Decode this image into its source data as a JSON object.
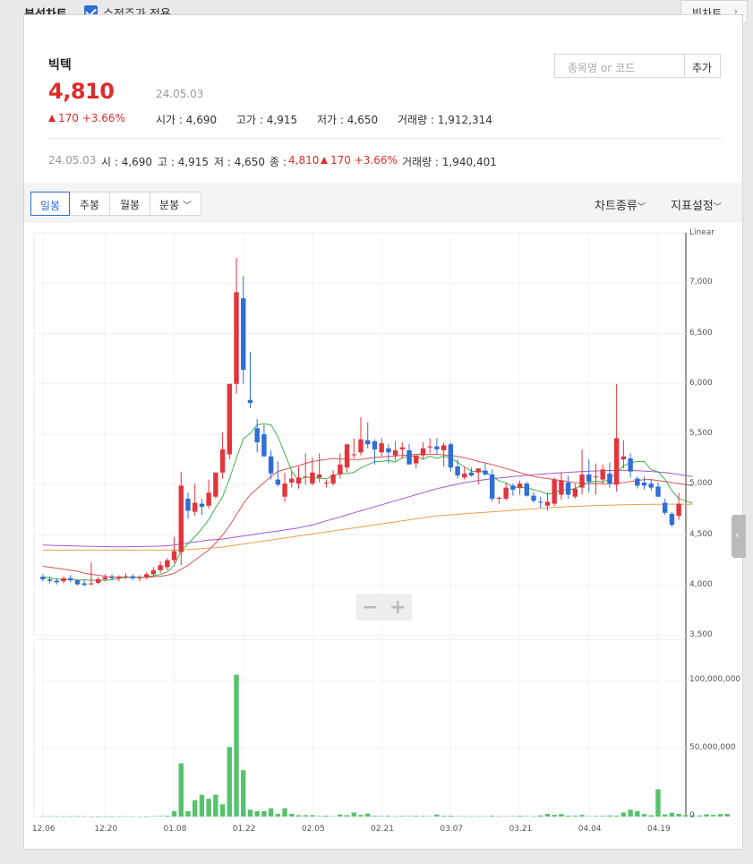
{
  "header": {
    "title": "분석차트",
    "adjusted_label": "수정주가 적용",
    "adjusted_checked": true,
    "big_chart_label": "빅차트"
  },
  "stock": {
    "name": "빅텍",
    "price": "4,810",
    "date": "24.05.03",
    "change": "170 +3.66%",
    "open": "시가 : 4,690",
    "high": "고가 : 4,915",
    "low": "저가 : 4,650",
    "volume": "거래량 : 1,912,314"
  },
  "search": {
    "placeholder": "종목명 or 코드",
    "add_label": "추가"
  },
  "summary": {
    "date": "24.05.03",
    "open": "시 : 4,690",
    "high": "고 : 4,915",
    "low": "저 : 4,650",
    "close_label": "종 :",
    "close": "4,810",
    "change": "170 +3.66%",
    "volume": "거래량 : 1,940,401"
  },
  "toolbar": {
    "tabs": [
      "일봉",
      "주봉",
      "월봉",
      "분봉"
    ],
    "active_tab": "일봉",
    "chart_type_label": "차트종류",
    "indicator_label": "지표설정"
  },
  "colors": {
    "up": "#e3343c",
    "down": "#2f6ed6",
    "ma5": "#3cb44b",
    "ma20": "#d9534f",
    "ma60": "#a855d6",
    "ma120": "#e8a04a",
    "volume": "#56c26e"
  },
  "chart_data": {
    "type": "candlestick",
    "scale_label": "Linear",
    "ylim": [
      3500,
      7500
    ],
    "yticks": [
      "7,000",
      "6,500",
      "6,000",
      "5,500",
      "5,000",
      "4,500",
      "4,000",
      "3,500"
    ],
    "volume_ylim": [
      0,
      130000000
    ],
    "volume_ticks": [
      "100,000,000",
      "50,000,000",
      "0"
    ],
    "x_labels": [
      "12.06",
      "12.20",
      "01.08",
      "01.22",
      "02.05",
      "02.21",
      "03.07",
      "03.21",
      "04.04",
      "04.19"
    ],
    "candles": [
      [
        4085,
        4110,
        4040,
        4060
      ],
      [
        4060,
        4090,
        4020,
        4045
      ],
      [
        4045,
        4070,
        4010,
        4030
      ],
      [
        4040,
        4090,
        4020,
        4070
      ],
      [
        4070,
        4100,
        4030,
        4050
      ],
      [
        4050,
        4060,
        4000,
        4010
      ],
      [
        4020,
        4050,
        3990,
        4005
      ],
      [
        4010,
        4230,
        4000,
        4020
      ],
      [
        4025,
        4080,
        4010,
        4060
      ],
      [
        4060,
        4110,
        4040,
        4080
      ],
      [
        4080,
        4110,
        4050,
        4070
      ],
      [
        4070,
        4100,
        4040,
        4085
      ],
      [
        4085,
        4120,
        4060,
        4090
      ],
      [
        4090,
        4110,
        4050,
        4070
      ],
      [
        4070,
        4100,
        4040,
        4080
      ],
      [
        4080,
        4130,
        4060,
        4110
      ],
      [
        4110,
        4180,
        4090,
        4150
      ],
      [
        4150,
        4240,
        4120,
        4200
      ],
      [
        4180,
        4270,
        4150,
        4250
      ],
      [
        4250,
        4480,
        4220,
        4340
      ],
      [
        4330,
        5130,
        4200,
        4990
      ],
      [
        4860,
        4920,
        4660,
        4740
      ],
      [
        4730,
        5010,
        4690,
        4820
      ],
      [
        4810,
        4860,
        4700,
        4780
      ],
      [
        4790,
        5050,
        4760,
        4920
      ],
      [
        4880,
        5030,
        4860,
        5120
      ],
      [
        5120,
        5520,
        5060,
        5350
      ],
      [
        5300,
        6000,
        5250,
        6000
      ],
      [
        6000,
        7250,
        5900,
        6910
      ],
      [
        6850,
        7070,
        6000,
        6140
      ],
      [
        5840,
        6320,
        5760,
        5810
      ],
      [
        5560,
        5650,
        5320,
        5420
      ],
      [
        5500,
        5590,
        5320,
        5280
      ],
      [
        5280,
        5340,
        5050,
        5110
      ],
      [
        5050,
        5230,
        4980,
        5000
      ],
      [
        4880,
        5120,
        4830,
        5010
      ],
      [
        5020,
        5130,
        4970,
        5060
      ],
      [
        5010,
        5180,
        4960,
        5070
      ],
      [
        5070,
        5310,
        5000,
        5080
      ],
      [
        5010,
        5270,
        4990,
        5120
      ],
      [
        5070,
        5310,
        5020,
        5100
      ],
      [
        5020,
        5050,
        4970,
        5020
      ],
      [
        5010,
        5140,
        4990,
        5100
      ],
      [
        5100,
        5310,
        5060,
        5200
      ],
      [
        5170,
        5370,
        5120,
        5400
      ],
      [
        5300,
        5460,
        5260,
        5300
      ],
      [
        5320,
        5670,
        5290,
        5450
      ],
      [
        5440,
        5620,
        5360,
        5400
      ],
      [
        5430,
        5450,
        5200,
        5350
      ],
      [
        5320,
        5460,
        5280,
        5410
      ],
      [
        5360,
        5400,
        5210,
        5320
      ],
      [
        5290,
        5430,
        5240,
        5340
      ],
      [
        5350,
        5420,
        5260,
        5370
      ],
      [
        5340,
        5400,
        5220,
        5200
      ],
      [
        5210,
        5280,
        5160,
        5290
      ],
      [
        5290,
        5420,
        5250,
        5360
      ],
      [
        5370,
        5460,
        5310,
        5380
      ],
      [
        5380,
        5460,
        5300,
        5350
      ],
      [
        5340,
        5420,
        5180,
        5390
      ],
      [
        5400,
        5420,
        5130,
        5170
      ],
      [
        5180,
        5250,
        5060,
        5090
      ],
      [
        5070,
        5180,
        5050,
        5110
      ],
      [
        5120,
        5170,
        5080,
        5090
      ],
      [
        5120,
        5160,
        5000,
        5160
      ],
      [
        5140,
        5210,
        5090,
        5100
      ],
      [
        5100,
        5150,
        4830,
        4860
      ],
      [
        4860,
        4880,
        4810,
        4870
      ],
      [
        4860,
        5020,
        4840,
        4970
      ],
      [
        4990,
        5010,
        4890,
        4950
      ],
      [
        4970,
        5040,
        4900,
        5010
      ],
      [
        5010,
        5030,
        4880,
        4890
      ],
      [
        4890,
        4920,
        4820,
        4840
      ],
      [
        4830,
        4880,
        4770,
        4820
      ],
      [
        4790,
        4920,
        4740,
        4830
      ],
      [
        4810,
        5070,
        4790,
        5050
      ],
      [
        4900,
        5120,
        4850,
        5040
      ],
      [
        5020,
        5090,
        4860,
        4900
      ],
      [
        4880,
        5010,
        4860,
        4960
      ],
      [
        4970,
        5350,
        4900,
        5100
      ],
      [
        5100,
        5250,
        4920,
        5030
      ],
      [
        5080,
        5210,
        4900,
        5080
      ],
      [
        5050,
        5200,
        5000,
        5150
      ],
      [
        5110,
        5220,
        4970,
        5010
      ],
      [
        5000,
        6000,
        4930,
        5460
      ],
      [
        5250,
        5440,
        5160,
        5280
      ],
      [
        5260,
        5310,
        5070,
        5130
      ],
      [
        5060,
        5080,
        4960,
        4990
      ],
      [
        5020,
        5080,
        4950,
        4990
      ],
      [
        5010,
        5050,
        4940,
        4970
      ],
      [
        4980,
        5020,
        4880,
        4880
      ],
      [
        4820,
        4860,
        4700,
        4720
      ],
      [
        4710,
        4730,
        4580,
        4600
      ],
      [
        4690,
        4915,
        4650,
        4810
      ]
    ],
    "volumes": [
      0.2,
      0.2,
      0.2,
      0.1,
      0.2,
      0.2,
      0.2,
      0.1,
      0.1,
      0.2,
      0.1,
      0.1,
      0.2,
      0.1,
      0.1,
      0.1,
      0.3,
      0.4,
      0.6,
      4.0,
      39.0,
      4.0,
      12.0,
      16.0,
      13.0,
      16.0,
      9.0,
      51.0,
      104.0,
      34.0,
      5.0,
      4.0,
      4.0,
      6.0,
      2.0,
      6.0,
      2.0,
      1.0,
      1.0,
      1.0,
      0.4,
      0.6,
      0.3,
      1.5,
      1.0,
      3.0,
      1.2,
      2.2,
      0.5,
      0.4,
      0.5,
      0.3,
      0.4,
      0.3,
      0.6,
      0.4,
      0.3,
      1.5,
      0.5,
      0.6,
      0.3,
      0.3,
      0.2,
      0.3,
      0.3,
      0.5,
      0.3,
      0.2,
      0.3,
      0.6,
      0.3,
      0.2,
      0.8,
      2.0,
      1.2,
      1.8,
      0.6,
      0.7,
      1.2,
      0.3,
      0.4,
      0.5,
      0.8,
      0.7,
      3.0,
      5.0,
      4.0,
      1.8,
      0.9,
      20.0,
      1.5,
      2.8,
      2.0,
      1.0,
      0.9,
      0.8,
      1.6,
      1.2,
      1.8,
      1.9
    ],
    "volume_unit": "million",
    "ma5": [
      4085,
      4076,
      4063,
      4057,
      4063,
      4052,
      4055,
      4050,
      4050,
      4050,
      4055,
      4069,
      4080,
      4079,
      4077,
      4083,
      4096,
      4107,
      4134,
      4199,
      4341,
      4413,
      4482,
      4563,
      4653,
      4774,
      4878,
      5059,
      5261,
      5455,
      5510,
      5596,
      5602,
      5594,
      5477,
      5307,
      5134,
      5040,
      5077,
      5066,
      5064,
      5057,
      5083,
      5110,
      5109,
      5122,
      5165,
      5197,
      5227,
      5230,
      5239,
      5226,
      5265,
      5283,
      5280,
      5252,
      5282,
      5262,
      5281,
      5267,
      5219,
      5176,
      5134,
      5129,
      5131,
      5079,
      5037,
      5017,
      4977,
      4969,
      4973,
      4948,
      4933,
      4904,
      4918,
      4949,
      4945,
      4962,
      4993,
      5023,
      5032,
      5030,
      5055,
      5116,
      5187,
      5218,
      5229,
      5230,
      5148,
      5128,
      5050,
      4940,
      4862,
      4836,
      4815
    ],
    "ma20": [
      4190,
      4180,
      4170,
      4160,
      4150,
      4140,
      4120,
      4110,
      4100,
      4090,
      4085,
      4082,
      4080,
      4080,
      4080,
      4080,
      4085,
      4090,
      4100,
      4120,
      4160,
      4200,
      4250,
      4300,
      4350,
      4420,
      4500,
      4590,
      4700,
      4810,
      4900,
      4960,
      5020,
      5080,
      5130,
      5150,
      5170,
      5190,
      5210,
      5230,
      5240,
      5250,
      5260,
      5255,
      5250,
      5248,
      5250,
      5260,
      5270,
      5275,
      5280,
      5285,
      5290,
      5295,
      5300,
      5300,
      5300,
      5300,
      5295,
      5290,
      5280,
      5265,
      5250,
      5230,
      5215,
      5200,
      5180,
      5160,
      5140,
      5120,
      5100,
      5080,
      5070,
      5060,
      5050,
      5040,
      5030,
      5020,
      5015,
      5010,
      5010,
      5010,
      5010,
      5015,
      5020,
      5030,
      5040,
      5050,
      5050,
      5040,
      5030,
      5020,
      5010,
      5000,
      4990
    ],
    "ma60": [
      4400,
      4398,
      4396,
      4394,
      4392,
      4390,
      4388,
      4386,
      4385,
      4384,
      4383,
      4383,
      4383,
      4384,
      4385,
      4386,
      4388,
      4390,
      4393,
      4400,
      4410,
      4420,
      4430,
      4440,
      4450,
      4455,
      4460,
      4470,
      4480,
      4490,
      4500,
      4510,
      4520,
      4530,
      4540,
      4550,
      4560,
      4570,
      4585,
      4600,
      4620,
      4640,
      4660,
      4680,
      4700,
      4720,
      4740,
      4760,
      4780,
      4800,
      4820,
      4840,
      4860,
      4880,
      4900,
      4920,
      4940,
      4960,
      4975,
      4990,
      5005,
      5020,
      5030,
      5040,
      5050,
      5058,
      5065,
      5072,
      5080,
      5086,
      5092,
      5098,
      5103,
      5108,
      5113,
      5118,
      5122,
      5126,
      5130,
      5134,
      5136,
      5138,
      5140,
      5142,
      5142,
      5140,
      5138,
      5135,
      5130,
      5125,
      5120,
      5110,
      5100,
      5090,
      5080
    ],
    "ma120": [
      4350,
      4350,
      4350,
      4350,
      4350,
      4350,
      4350,
      4350,
      4350,
      4350,
      4350,
      4350,
      4350,
      4350,
      4350,
      4350,
      4350,
      4350,
      4350,
      4350,
      4350,
      4355,
      4360,
      4365,
      4370,
      4375,
      4380,
      4390,
      4400,
      4410,
      4420,
      4430,
      4440,
      4450,
      4460,
      4470,
      4480,
      4490,
      4500,
      4510,
      4520,
      4530,
      4540,
      4550,
      4560,
      4570,
      4580,
      4590,
      4600,
      4610,
      4620,
      4630,
      4640,
      4650,
      4660,
      4670,
      4680,
      4690,
      4695,
      4700,
      4705,
      4710,
      4715,
      4720,
      4725,
      4730,
      4735,
      4740,
      4745,
      4750,
      4755,
      4760,
      4765,
      4770,
      4775,
      4778,
      4781,
      4784,
      4787,
      4790,
      4792,
      4794,
      4796,
      4798,
      4800,
      4801,
      4802,
      4803,
      4804,
      4805,
      4806,
      4806,
      4806,
      4805,
      4805
    ]
  }
}
